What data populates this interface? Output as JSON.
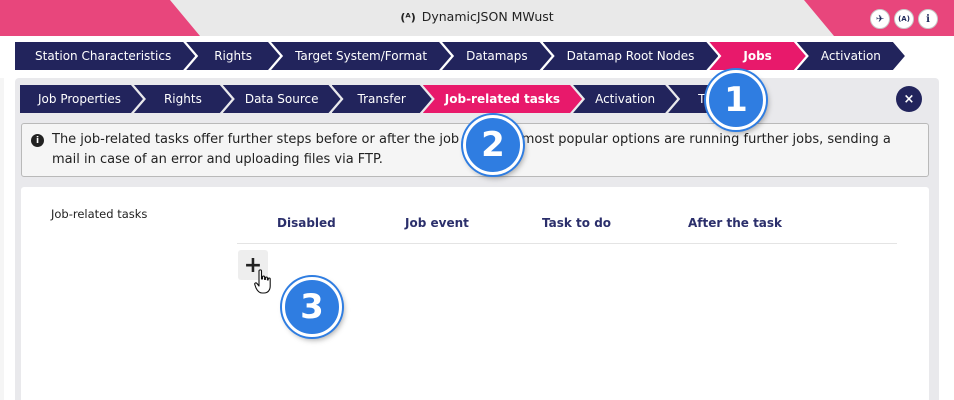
{
  "window": {
    "title": "DynamicJSON MWust",
    "title_icon": "antenna-icon",
    "buttons": [
      {
        "icon": "airplane-icon",
        "glyph": "✈"
      },
      {
        "icon": "antenna-icon",
        "glyph": "(A)"
      },
      {
        "icon": "info-icon",
        "glyph": "i"
      }
    ]
  },
  "outer_nav": {
    "items": [
      "Station Characteristics",
      "Rights",
      "Target System/Format",
      "Datamaps",
      "Datamap Root Nodes",
      "Jobs",
      "Activation"
    ],
    "active": "Jobs"
  },
  "inner_nav": {
    "items": [
      "Job Properties",
      "Rights",
      "Data Source",
      "Transfer",
      "Job-related tasks",
      "Activation",
      "To-do"
    ],
    "active": "Job-related tasks",
    "close_glyph": "×"
  },
  "info": {
    "text": "The job-related tasks offer further steps before or after the job run. The most popular options are running further jobs, sending a mail in case of an error and uploading files via FTP."
  },
  "tasks": {
    "section_label": "Job-related tasks",
    "columns": [
      "Disabled",
      "Job event",
      "Task to do",
      "After the task"
    ],
    "add_glyph": "+"
  },
  "badges": [
    "1",
    "2",
    "3"
  ],
  "colors": {
    "navy": "#22245c",
    "pink": "#e8196b",
    "title_pink": "#e8467c",
    "badge_blue": "#2f7de1"
  }
}
